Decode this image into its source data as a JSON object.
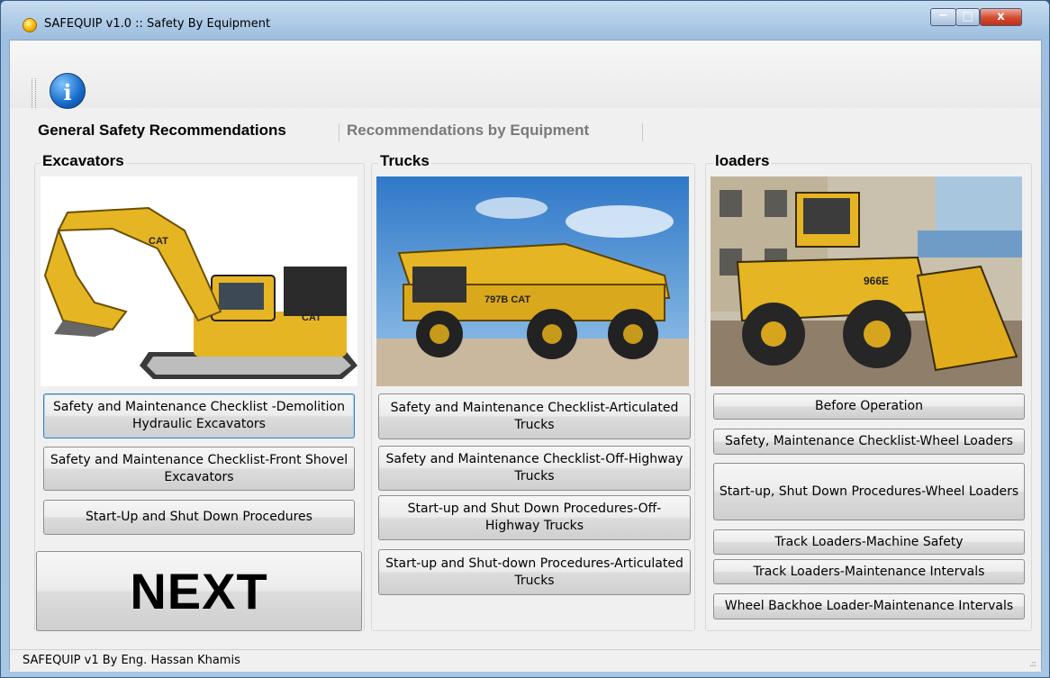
{
  "window": {
    "title": "SAFEQUIP v1.0 :: Safety By Equipment"
  },
  "title_controls": {
    "minimize": "−",
    "maximize": "□",
    "close": "x"
  },
  "toolbar": {
    "info_icon": "info-icon"
  },
  "tabs": [
    {
      "label": "General Safety Recommendations",
      "active": true
    },
    {
      "label": "Recommendations by Equipment",
      "active": false
    }
  ],
  "groups": {
    "excavators": {
      "title": "Excavators",
      "buttons": [
        "Safety and Maintenance Checklist -Demolition Hydraulic Excavators",
        "Safety and Maintenance Checklist-Front Shovel Excavators",
        "Start-Up and Shut Down Procedures"
      ]
    },
    "trucks": {
      "title": "Trucks",
      "buttons": [
        "Safety and Maintenance Checklist-Articulated Trucks",
        "Safety and Maintenance Checklist-Off-Highway Trucks",
        "Start-up and Shut Down Procedures-Off-Highway Trucks",
        "Start-up and Shut-down Procedures-Articulated Trucks"
      ]
    },
    "loaders": {
      "title": "loaders",
      "buttons": [
        "Before Operation",
        "Safety, Maintenance Checklist-Wheel Loaders",
        "Start-up, Shut Down Procedures-Wheel Loaders",
        "Track Loaders-Machine Safety",
        "Track Loaders-Maintenance Intervals",
        "Wheel Backhoe Loader-Maintenance Intervals"
      ]
    }
  },
  "next_button": {
    "label": "NEXT"
  },
  "status_bar": {
    "text": "SAFEQUIP v1 By Eng. Hassan Khamis"
  },
  "colors": {
    "equipment_yellow": "#e6b523",
    "sky": "#6aa8dc",
    "inactive_tab": "#7a7a7a"
  }
}
